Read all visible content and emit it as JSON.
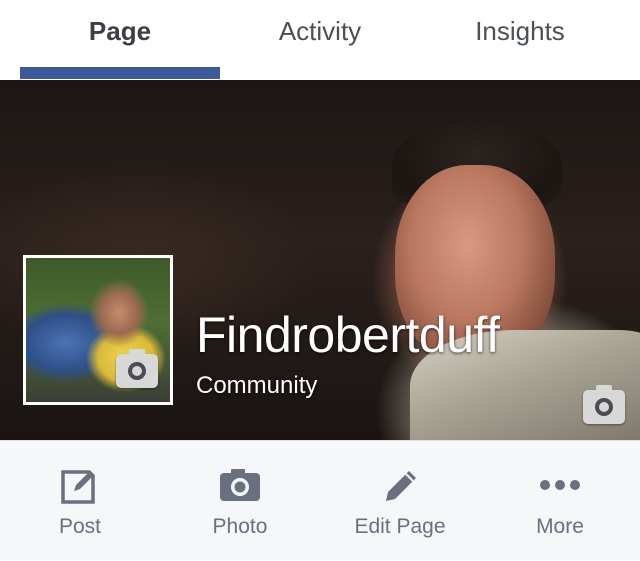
{
  "tabs": [
    {
      "label": "Page",
      "active": true
    },
    {
      "label": "Activity",
      "active": false
    },
    {
      "label": "Insights",
      "active": false
    }
  ],
  "cover": {
    "page_name": "Findrobertduff",
    "category": "Community",
    "camera_icon": "camera-icon"
  },
  "profile": {
    "camera_icon": "camera-icon"
  },
  "actions": [
    {
      "label": "Post",
      "icon": "compose-icon"
    },
    {
      "label": "Photo",
      "icon": "camera-icon"
    },
    {
      "label": "Edit Page",
      "icon": "pencil-icon"
    },
    {
      "label": "More",
      "icon": "more-dots-icon"
    }
  ],
  "colors": {
    "accent": "#3b5998",
    "icon": "#6a7080",
    "action_bar_bg": "#f6f7f9"
  }
}
